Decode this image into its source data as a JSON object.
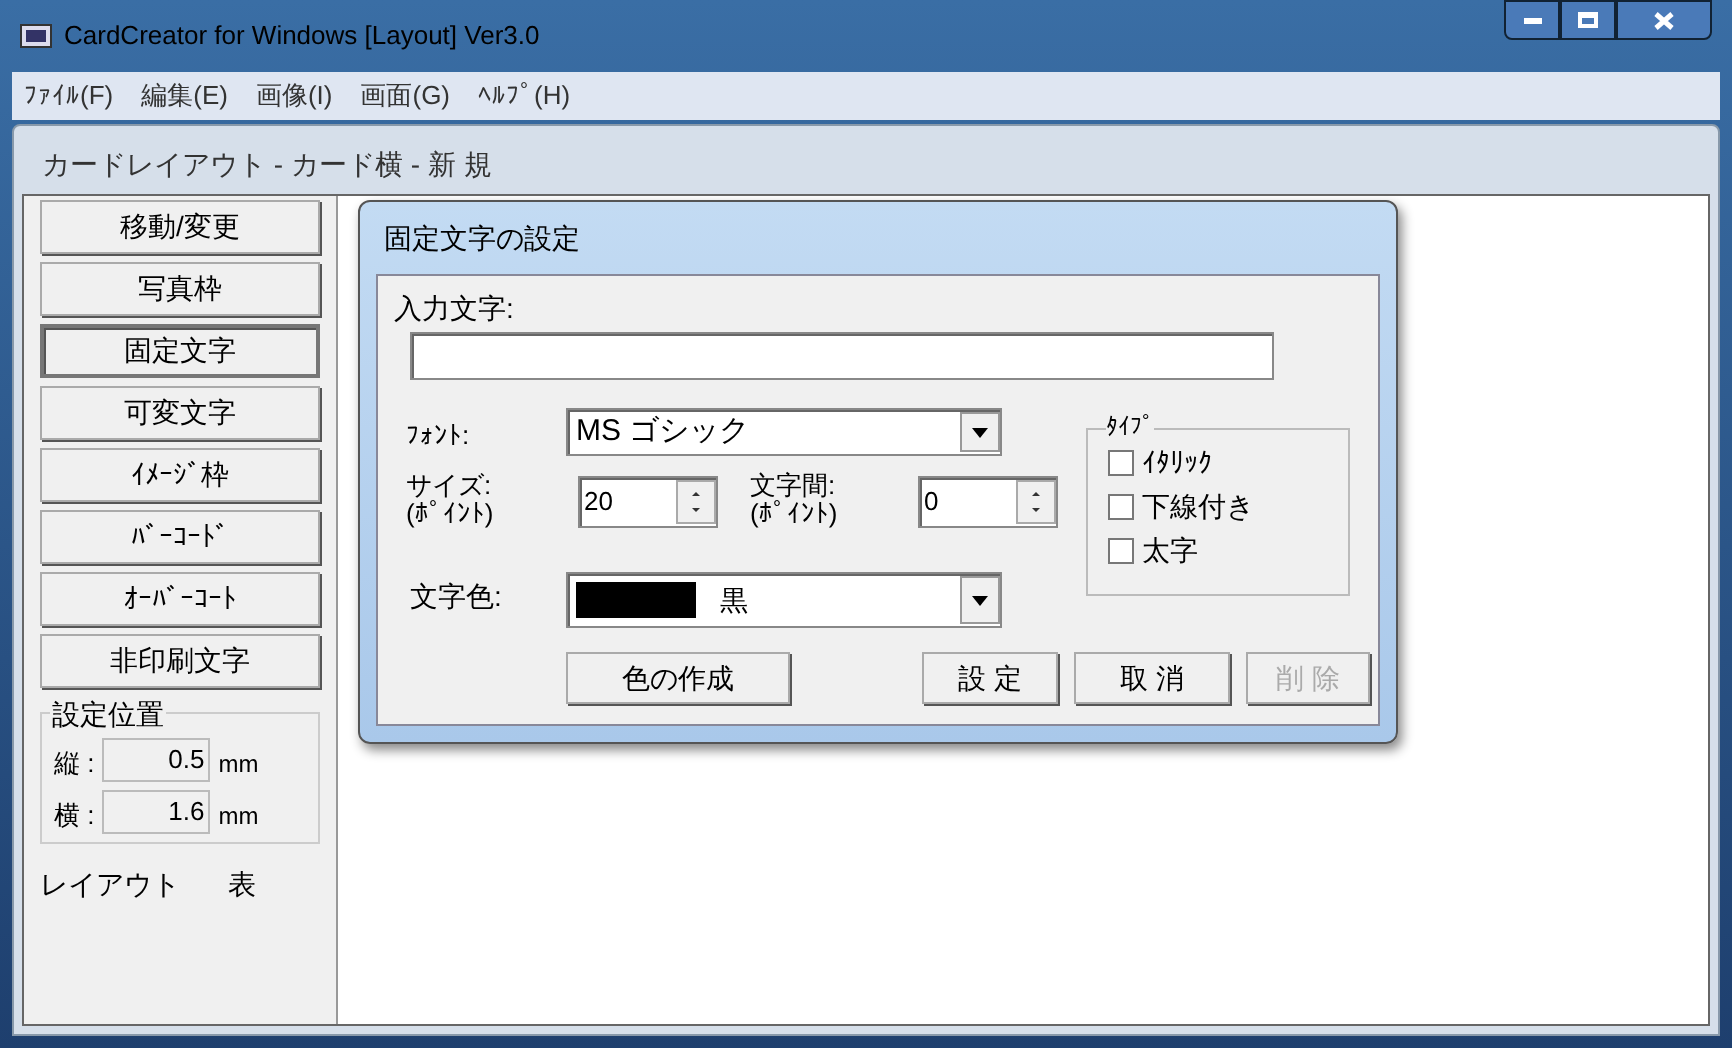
{
  "window": {
    "title": "CardCreator for Windows [Layout] Ver3.0"
  },
  "menu": [
    "ﾌｧｲﾙ(F)",
    "編集(E)",
    "画像(I)",
    "画面(G)",
    "ﾍﾙﾌﾟ(H)"
  ],
  "document": {
    "title": "カードレイアウト - カード横 - 新 規"
  },
  "tools": [
    {
      "label": "移動/変更",
      "selected": false
    },
    {
      "label": "写真枠",
      "selected": false
    },
    {
      "label": "固定文字",
      "selected": true
    },
    {
      "label": "可変文字",
      "selected": false
    },
    {
      "label": "ｲﾒｰｼﾞ枠",
      "selected": false
    },
    {
      "label": "ﾊﾞｰｺｰﾄﾞ",
      "selected": false
    },
    {
      "label": "ｵｰﾊﾞｰｺｰﾄ",
      "selected": false
    },
    {
      "label": "非印刷文字",
      "selected": false
    }
  ],
  "position": {
    "title": "設定位置",
    "rows": [
      {
        "label": "縦 :",
        "value": "0.5",
        "unit": "mm"
      },
      {
        "label": "横 :",
        "value": "1.6",
        "unit": "mm"
      }
    ]
  },
  "footer": {
    "mode": "レイアウト",
    "side": "表"
  },
  "dialog": {
    "title": "固定文字の設定",
    "input_label": "入力文字:",
    "font_label": "ﾌｫﾝﾄ:",
    "font": "MS ゴシック",
    "size_label": [
      "サイズ:",
      "(ﾎﾟｲﾝﾄ)"
    ],
    "size": "20",
    "spacing_label": [
      "文字間:",
      "(ﾎﾟｲﾝﾄ)"
    ],
    "spacing": "0",
    "color_label": "文字色:",
    "color_name": "黒",
    "color": "#000000",
    "type": {
      "title": "ﾀｲﾌﾟ",
      "options": [
        {
          "label": "ｲﾀﾘｯｸ",
          "checked": false
        },
        {
          "label": "下線付き",
          "checked": false
        },
        {
          "label": "太字",
          "checked": false
        }
      ]
    },
    "buttons": [
      {
        "label": "色の作成",
        "disabled": false
      },
      {
        "label": "設 定",
        "disabled": false
      },
      {
        "label": "取 消",
        "disabled": false
      },
      {
        "label": "削 除",
        "disabled": true
      }
    ]
  }
}
